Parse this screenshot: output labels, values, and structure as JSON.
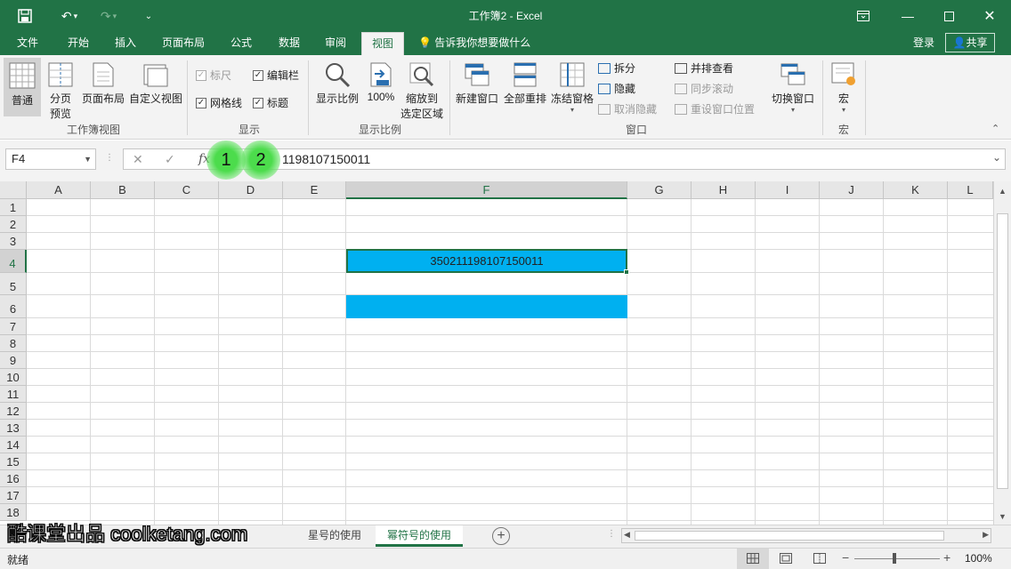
{
  "window": {
    "title": "工作簿2 - Excel",
    "accent": "#217346"
  },
  "menu": {
    "tabs": [
      "文件",
      "开始",
      "插入",
      "页面布局",
      "公式",
      "数据",
      "审阅",
      "视图"
    ],
    "active_tab": "视图",
    "tell_me": "告诉我你想要做什么",
    "login": "登录",
    "share": "共享"
  },
  "ribbon": {
    "workbook_views": {
      "label": "工作簿视图",
      "normal": "普通",
      "page_break_1": "分页",
      "page_break_2": "预览",
      "page_layout": "页面布局",
      "custom_views": "自定义视图"
    },
    "show": {
      "label": "显示",
      "ruler": "标尺",
      "formula_bar": "编辑栏",
      "gridlines": "网格线",
      "headings": "标题"
    },
    "zoom": {
      "label": "显示比例",
      "zoom": "显示比例",
      "zoom_100": "100%",
      "zoom_selection_1": "缩放到",
      "zoom_selection_2": "选定区域"
    },
    "window": {
      "label": "窗口",
      "new_window": "新建窗口",
      "arrange_all": "全部重排",
      "freeze_panes": "冻结窗格",
      "split": "拆分",
      "hide": "隐藏",
      "unhide": "取消隐藏",
      "side_by_side": "并排查看",
      "sync_scroll": "同步滚动",
      "reset_position": "重设窗口位置",
      "switch_windows": "切换窗口"
    },
    "macros": {
      "label": "宏",
      "macros": "宏"
    }
  },
  "formula_bar": {
    "name_box": "F4",
    "fx": "fx",
    "visible_value_tail": "1198107150011",
    "marker_1": "1",
    "marker_2": "2"
  },
  "grid": {
    "columns": [
      "A",
      "B",
      "C",
      "D",
      "E",
      "F",
      "G",
      "H",
      "I",
      "J",
      "K",
      "L"
    ],
    "rows": [
      "1",
      "2",
      "3",
      "4",
      "5",
      "6",
      "7",
      "8",
      "9",
      "10",
      "11",
      "12",
      "13",
      "14",
      "15",
      "16",
      "17",
      "18"
    ],
    "selected_cell": "F4",
    "cell_F4": "350211198107150011",
    "highlight_color": "#00b0f0"
  },
  "sheets": {
    "tabs": [
      "星号的使用",
      "幂符号的使用"
    ],
    "active": "幂符号的使用"
  },
  "watermark": "酷课堂出品 coolketang.com",
  "status": {
    "ready": "就绪",
    "zoom_level": "100%"
  }
}
